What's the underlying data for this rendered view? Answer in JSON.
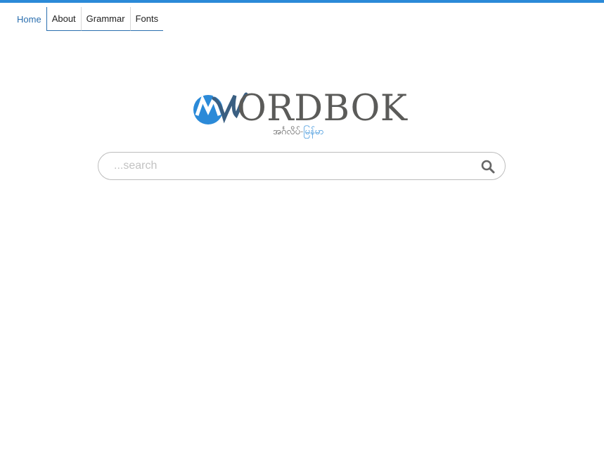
{
  "nav": {
    "items": [
      {
        "label": "Home"
      },
      {
        "label": "About"
      },
      {
        "label": "Grammar"
      },
      {
        "label": "Fonts"
      }
    ]
  },
  "logo": {
    "wordmark": "ORDBOK",
    "subtitle_from": "အင်္ဂလိပ်",
    "subtitle_sep": "-",
    "subtitle_to": "မြန်မာ"
  },
  "search": {
    "placeholder": "...search",
    "value": ""
  },
  "colors": {
    "accent": "#2b8ad8",
    "nav_active": "#2b6faf",
    "logo_gray": "#5b5b59",
    "logo_dark_blue": "#3a5f82"
  },
  "icons": {
    "search": "search-icon",
    "logo_mark": "mw-logo-icon"
  }
}
